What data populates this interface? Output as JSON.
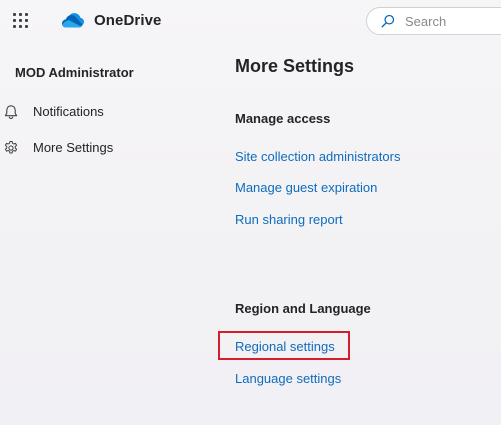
{
  "header": {
    "app_name": "OneDrive",
    "search": {
      "placeholder": "Search",
      "value": ""
    },
    "icons": {
      "launcher": "app-launcher-waffle-icon",
      "logo": "onedrive-cloud-icon",
      "search": "search-icon"
    }
  },
  "sidebar": {
    "user_name": "MOD Administrator",
    "items": [
      {
        "label": "Notifications",
        "icon": "bell-icon"
      },
      {
        "label": "More Settings",
        "icon": "gear-icon"
      }
    ]
  },
  "main": {
    "title": "More Settings",
    "sections": [
      {
        "heading": "Manage access",
        "links": [
          {
            "label": "Site collection administrators"
          },
          {
            "label": "Manage guest expiration"
          },
          {
            "label": "Run sharing report"
          }
        ]
      },
      {
        "heading": "Region and Language",
        "links": [
          {
            "label": "Regional settings",
            "highlighted": true
          },
          {
            "label": "Language settings"
          }
        ]
      }
    ]
  },
  "colors": {
    "link": "#0f6cbd",
    "highlight_border": "#d21f2e",
    "onedrive_blue": "#0364b8"
  }
}
